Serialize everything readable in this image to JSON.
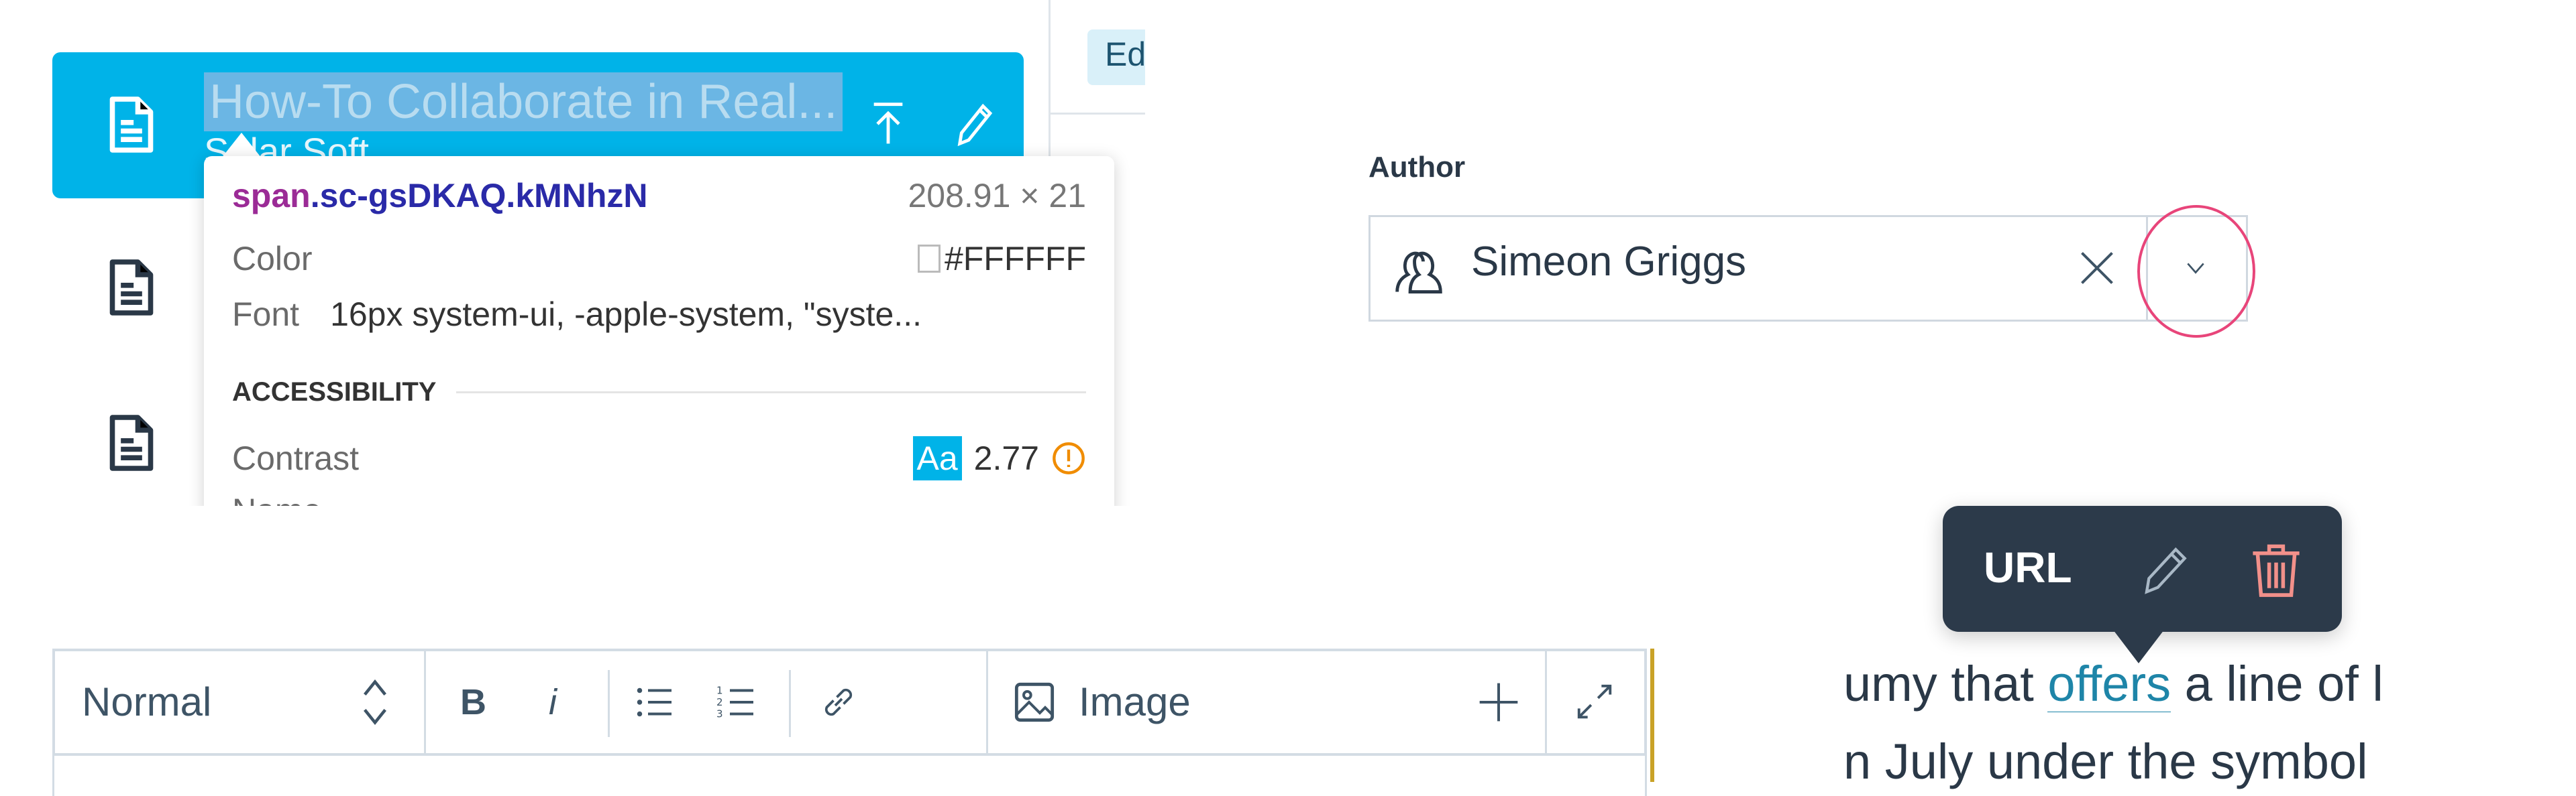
{
  "document_list": {
    "selected_item": {
      "title": "How-To Collaborate in Real...",
      "subtitle": "Solar Soft"
    },
    "icons": [
      "document-icon",
      "upload-icon",
      "pencil-icon"
    ],
    "selected_color": "#00B3E8"
  },
  "inspector_tooltip": {
    "element_tag": "span",
    "element_class": ".sc-gsDKAQ.kMNhzN",
    "dimensions": "208.91 × 21",
    "color_label": "Color",
    "color_value": "#FFFFFF",
    "font_label": "Font",
    "font_value": "16px system-ui, -apple-system, \"syste...",
    "accessibility_heading": "ACCESSIBILITY",
    "contrast_label": "Contrast",
    "contrast_badge": "Aa",
    "contrast_value": "2.77",
    "name_label": "Name",
    "warning_color": "#F08C00"
  },
  "tab_badge": "Ed",
  "author_field": {
    "label": "Author",
    "value": "Simeon Griggs",
    "highlight_color": "#E8457A"
  },
  "editor_toolbar": {
    "style_select": "Normal",
    "bold": "B",
    "italic": "i",
    "image_label": "Image"
  },
  "link_popover": {
    "label": "URL",
    "delete_color": "#F2908A"
  },
  "body_text": {
    "line1_before": "umy that ",
    "link": "offers",
    "line1_after": " a line of l",
    "line2": "n July under the symbol",
    "link_color": "#1E85A8"
  }
}
